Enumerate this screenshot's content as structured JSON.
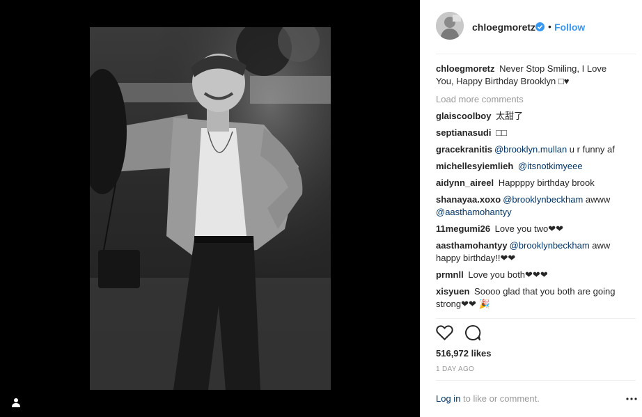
{
  "post": {
    "username": "chloegmoretz",
    "verified": true,
    "dot": "•",
    "follow_label": "Follow",
    "caption_user": "chloegmoretz",
    "caption_text": "Never Stop Smiling, I Love You, Happy Birthday Brooklyn □♥",
    "load_more": "Load more comments",
    "likes": "516,972 likes",
    "timestamp": "1 DAY AGO",
    "login_link": "Log in",
    "login_suffix": " to like or comment."
  },
  "comments": [
    {
      "user": "glaiscoolboy",
      "text": "太甜了"
    },
    {
      "user": "septianasudi",
      "text": "□□"
    },
    {
      "user": "gracekranitis",
      "mention": "@brooklyn.mullan",
      "text": " u r funny af"
    },
    {
      "user": "michellesyiemlieh",
      "mention": "@itsnotkimyeee",
      "text": ""
    },
    {
      "user": "aidynn_aireel",
      "text": "Happppy birthday brook"
    },
    {
      "user": "shanayaa.xoxo",
      "mention": "@brooklynbeckham",
      "text": " awww ",
      "mention2": "@aasthamohantyy"
    },
    {
      "user": "11megumi26",
      "text": "Love you two❤❤"
    },
    {
      "user": "aasthamohantyy",
      "mention": "@brooklynbeckham",
      "text": " aww happy birthday!!❤❤"
    },
    {
      "user": "prmnll",
      "text": "Love you both❤❤❤"
    },
    {
      "user": "xisyuen",
      "text": "Soooo glad that you both are going strong❤❤ 🎉"
    }
  ],
  "colors": {
    "accent": "#3897f0",
    "mention": "#003569",
    "muted": "#999999",
    "verified": "#3897f0"
  },
  "icons": {
    "heart": "heart-icon",
    "comment": "comment-icon",
    "more": "more-options-icon",
    "verified": "verified-badge-icon",
    "tag_user": "tagged-user-icon"
  }
}
